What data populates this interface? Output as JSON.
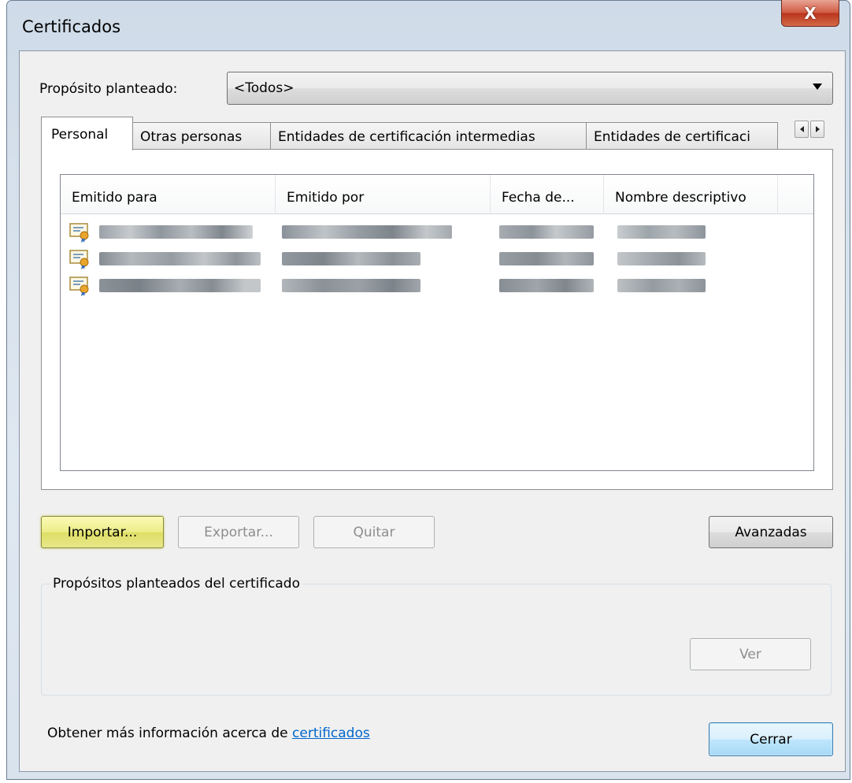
{
  "window": {
    "title": "Certificados",
    "close_glyph": "X"
  },
  "purpose": {
    "label": "Propósito planteado:",
    "value": "<Todos>"
  },
  "tabs": [
    {
      "label": "Personal",
      "selected": true
    },
    {
      "label": "Otras personas"
    },
    {
      "label": "Entidades de certificación intermedias"
    },
    {
      "label": "Entidades de certificaci"
    }
  ],
  "list": {
    "columns": [
      "Emitido para",
      "Emitido por",
      "Fecha de...",
      "Nombre descriptivo"
    ],
    "rows_icon": "certificate-icon"
  },
  "buttons": {
    "import": "Importar...",
    "export": "Exportar...",
    "remove": "Quitar",
    "advanced": "Avanzadas",
    "view": "Ver",
    "close": "Cerrar"
  },
  "group": {
    "label": "Propósitos planteados del certificado"
  },
  "footer": {
    "text": "Obtener más información acerca de ",
    "link": "certificados"
  },
  "colors": {
    "link": "#0066cc",
    "selection_hover": "#dede66",
    "default_button": "#bee6fd"
  }
}
